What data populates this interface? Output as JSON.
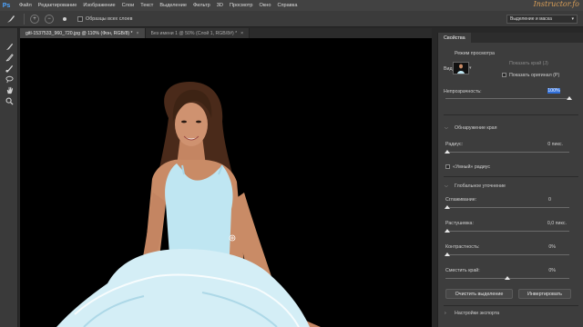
{
  "app": {
    "logo": "Ps",
    "watermark": "Instructor.fo"
  },
  "menu": [
    "Файл",
    "Редактирование",
    "Изображение",
    "Слои",
    "Текст",
    "Выделение",
    "Фильтр",
    "3D",
    "Просмотр",
    "Окно",
    "Справка"
  ],
  "options": {
    "sample_all_layers": "Образцы всех слоев",
    "workspace": "Выделение и маска"
  },
  "tabs": [
    {
      "label": "gitl-1537533_960_720.jpg @ 110% (Фон, RGB/8) *",
      "close": "×"
    },
    {
      "label": "Без имени 1 @ 50% (Слой 1, RGB/8#) *",
      "close": "×"
    }
  ],
  "tools": [
    "brush-icon",
    "refine-edge-brush-icon",
    "brush-icon",
    "quick-selection-icon",
    "lasso-icon",
    "hand-icon",
    "zoom-icon"
  ],
  "panel": {
    "tab": "Свойства",
    "view_mode": {
      "title": "Режим просмотра",
      "view_label": "Вид:",
      "show_edge": "Показать край (J)",
      "show_original": "Показать оригинал (P)"
    },
    "opacity": {
      "label": "Непрозрачность:",
      "value": "100%"
    },
    "edge_detection": {
      "title": "Обнаружение края",
      "radius_label": "Радиус:",
      "radius_value": "0 пикс.",
      "smart_radius": "«Умный» радиус"
    },
    "global_refinements": {
      "title": "Глобальное уточнение",
      "smooth_label": "Сглаживание:",
      "smooth_value": "0",
      "feather_label": "Растушевка:",
      "feather_value": "0,0 пикс.",
      "contrast_label": "Контрастность:",
      "contrast_value": "0%",
      "shift_edge_label": "Сместить край:",
      "shift_edge_value": "0%"
    },
    "buttons": {
      "clear": "Очистить выделение",
      "invert": "Инвертировать"
    },
    "output": {
      "title": "Настройки экспорта"
    }
  },
  "colors": {
    "accent": "#2f6ed8",
    "dress": "#bfe6f2",
    "skin": "#c98b66"
  }
}
